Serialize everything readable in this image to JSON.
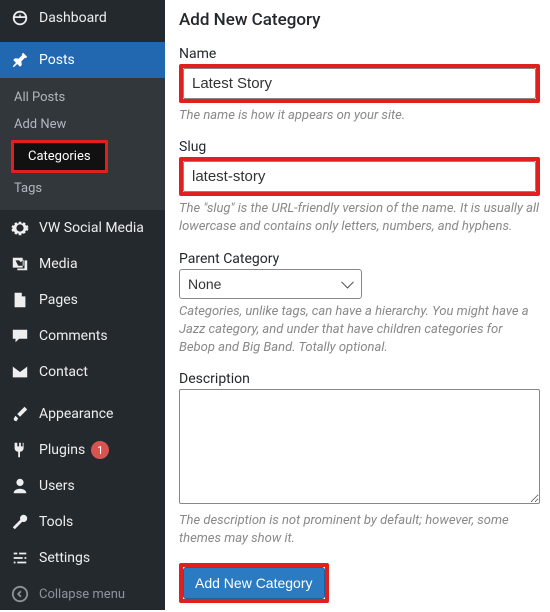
{
  "sidebar": {
    "items": [
      {
        "label": "Dashboard"
      },
      {
        "label": "Posts"
      },
      {
        "label": "VW Social Media"
      },
      {
        "label": "Media"
      },
      {
        "label": "Pages"
      },
      {
        "label": "Comments"
      },
      {
        "label": "Contact"
      },
      {
        "label": "Appearance"
      },
      {
        "label": "Plugins",
        "badge": "1"
      },
      {
        "label": "Users"
      },
      {
        "label": "Tools"
      },
      {
        "label": "Settings"
      },
      {
        "label": "Collapse menu"
      }
    ],
    "submenu": [
      {
        "label": "All Posts"
      },
      {
        "label": "Add New"
      },
      {
        "label": "Categories"
      },
      {
        "label": "Tags"
      }
    ]
  },
  "main": {
    "heading": "Add New Category",
    "name": {
      "label": "Name",
      "value": "Latest Story",
      "help": "The name is how it appears on your site."
    },
    "slug": {
      "label": "Slug",
      "value": "latest-story",
      "help": "The \"slug\" is the URL-friendly version of the name. It is usually all lowercase and contains only letters, numbers, and hyphens."
    },
    "parent": {
      "label": "Parent Category",
      "value": "None",
      "help": "Categories, unlike tags, can have a hierarchy. You might have a Jazz category, and under that have children categories for Bebop and Big Band. Totally optional."
    },
    "description": {
      "label": "Description",
      "value": "",
      "help": "The description is not prominent by default; however, some themes may show it."
    },
    "submit_label": "Add New Category"
  }
}
